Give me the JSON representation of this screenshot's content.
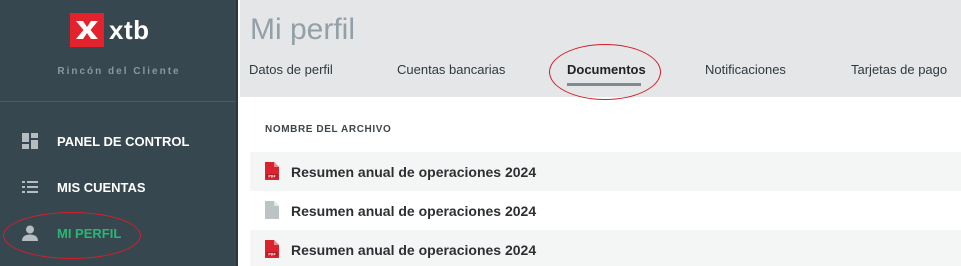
{
  "brand": {
    "logo_text": "xtb",
    "logo_color": "#e4222b",
    "subtitle": "Rincón del Cliente"
  },
  "sidebar": {
    "items": [
      {
        "label": "PANEL DE CONTROL",
        "icon": "dashboard-icon"
      },
      {
        "label": "MIS CUENTAS",
        "icon": "list-icon"
      },
      {
        "label": "MI PERFIL",
        "icon": "person-icon",
        "active": true
      }
    ]
  },
  "header": {
    "title": "Mi perfil",
    "tabs": [
      {
        "label": "Datos de perfil"
      },
      {
        "label": "Cuentas bancarias"
      },
      {
        "label": "Documentos",
        "active": true
      },
      {
        "label": "Notificaciones"
      },
      {
        "label": "Tarjetas de pago"
      }
    ]
  },
  "documents": {
    "column_header": "NOMBRE DEL ARCHIVO",
    "rows": [
      {
        "name": "Resumen anual de operaciones 2024",
        "icon": "pdf-file-icon"
      },
      {
        "name": "Resumen anual de operaciones 2024",
        "icon": "file-icon"
      },
      {
        "name": "Resumen anual de operaciones 2024",
        "icon": "pdf-file-icon"
      }
    ]
  },
  "colors": {
    "sidebar_bg": "#37474f",
    "active_green": "#2bb673",
    "annotation_red": "#d61e2b",
    "pdf_red": "#d9232e"
  }
}
